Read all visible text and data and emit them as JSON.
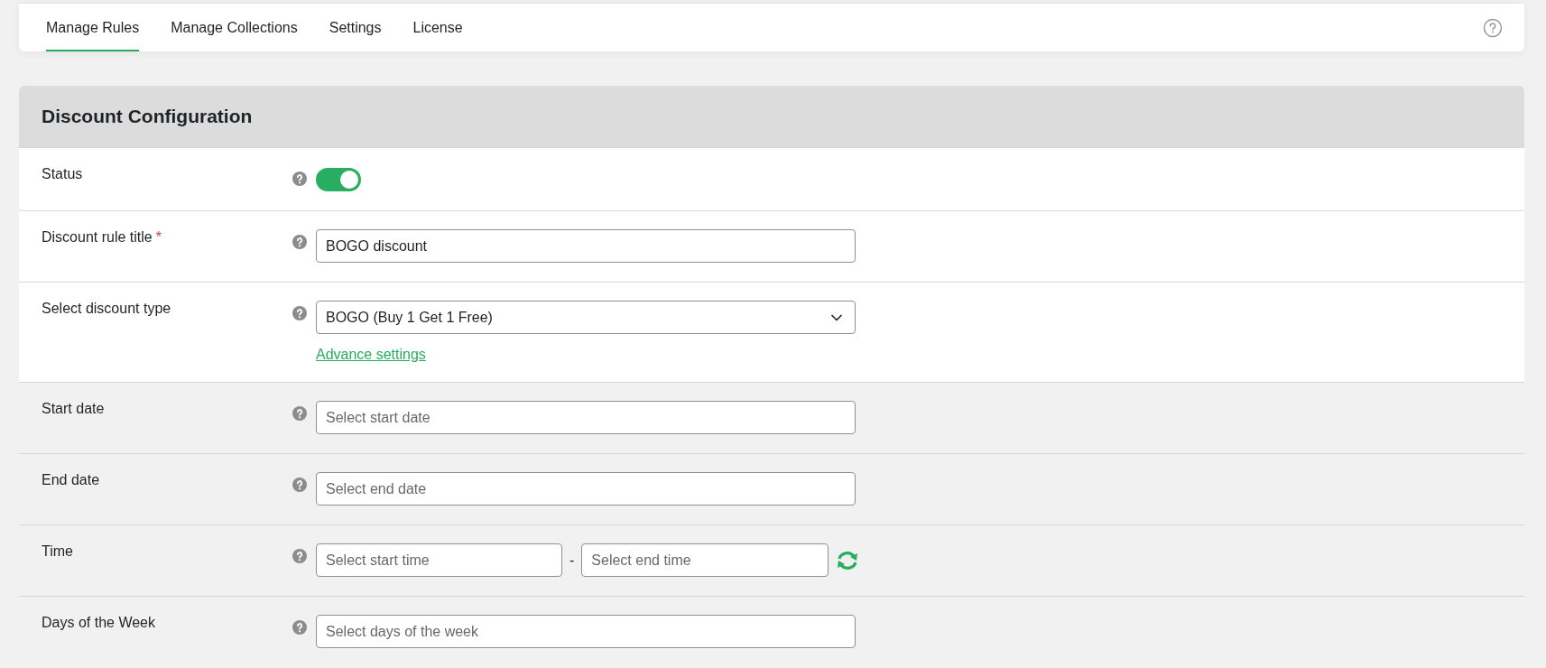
{
  "tabs": [
    {
      "label": "Manage Rules",
      "selected": true
    },
    {
      "label": "Manage Collections",
      "selected": false
    },
    {
      "label": "Settings",
      "selected": false
    },
    {
      "label": "License",
      "selected": false
    }
  ],
  "panel": {
    "title": "Discount Configuration",
    "rows": [
      {
        "kind": "toggle",
        "label": "Status",
        "shaded": false,
        "on": true
      },
      {
        "kind": "text",
        "label": "Discount rule title",
        "required_mark": "*",
        "shaded": false,
        "value": "BOGO discount"
      },
      {
        "kind": "select",
        "label": "Select discount type",
        "shaded": false,
        "value": "BOGO (Buy 1 Get 1 Free)",
        "link": "Advance settings"
      },
      {
        "kind": "text",
        "label": "Start date",
        "shaded": true,
        "placeholder": "Select start date"
      },
      {
        "kind": "text",
        "label": "End date",
        "shaded": true,
        "placeholder": "Select end date"
      },
      {
        "kind": "range",
        "label": "Time",
        "shaded": true,
        "placeholder": "Select start time",
        "separator": "-",
        "placeholder_end": "Select end time"
      },
      {
        "kind": "text",
        "label": "Days of the Week",
        "shaded": true,
        "placeholder": "Select days of the week"
      }
    ]
  }
}
